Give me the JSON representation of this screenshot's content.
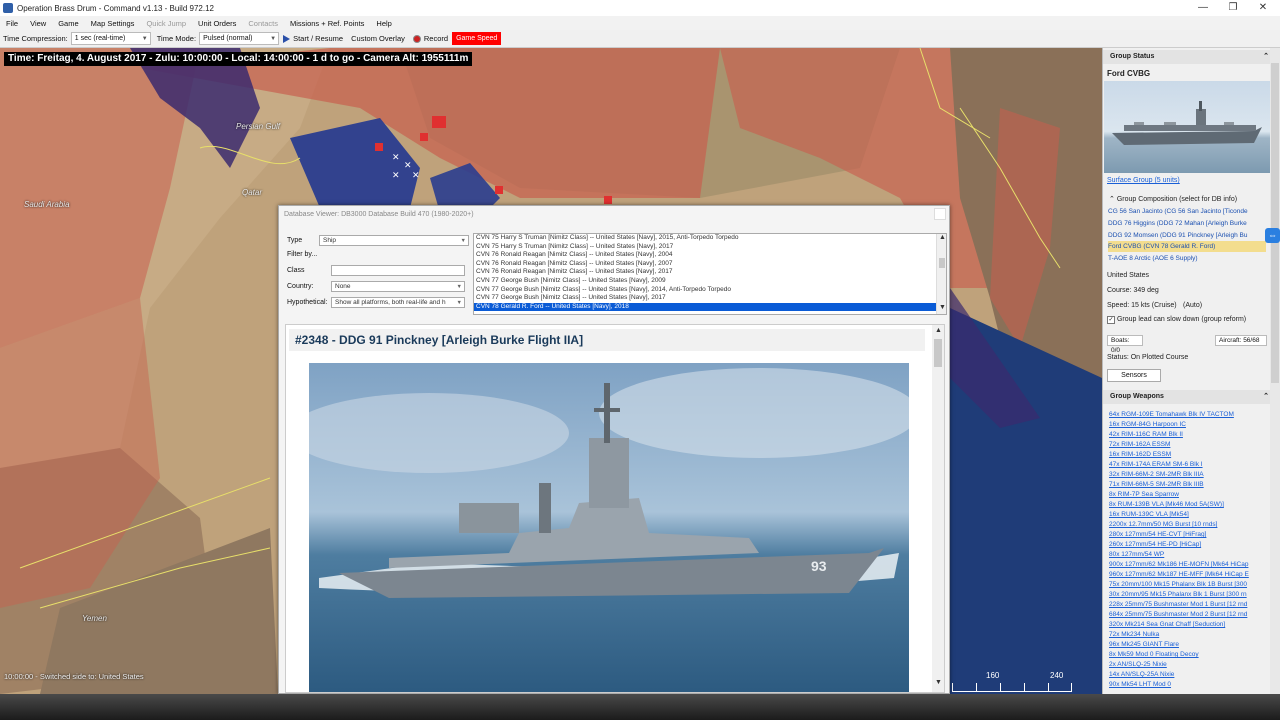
{
  "window": {
    "title": "Operation Brass Drum - Command v1.13 - Build 972.12",
    "minimize": "—",
    "restore": "❐",
    "close": "✕"
  },
  "menu": [
    "File",
    "View",
    "Game",
    "Map Settings",
    "Quick Jump",
    "Unit Orders",
    "Contacts",
    "Missions + Ref. Points",
    "Help"
  ],
  "menu_disabled": [
    "Quick Jump",
    "Contacts"
  ],
  "toolbar": {
    "time_compression_label": "Time Compression:",
    "time_compression_value": "1 sec (real-time)",
    "time_mode_label": "Time Mode:",
    "time_mode_value": "Pulsed (normal)",
    "start_resume": "Start / Resume",
    "custom_overlay": "Custom Overlay",
    "record": "Record",
    "game_speed": "Game Speed"
  },
  "map": {
    "time_readout": "Time: Freitag, 4. August 2017 - Zulu: 10:00:00 - Local: 14:00:00 - 1 d to go - Camera Alt: 1955111m",
    "labels": {
      "persian_gulf": "Persian Gulf",
      "saudi_arabia": "Saudi Arabia",
      "qatar": "Qatar",
      "yemen": "Yemen"
    },
    "status_message": "10:00:00 - Switched side to: United States",
    "scale_labels": [
      "160",
      "240"
    ]
  },
  "database_viewer": {
    "title": "Database Viewer: DB3000 Database Build 470 (1980-2020+)",
    "filters": {
      "type_label": "Type",
      "type_value": "Ship",
      "filter_by_label": "Filter by...",
      "class_label": "Class",
      "class_value": "",
      "country_label": "Country:",
      "country_value": "None",
      "hypothetical_label": "Hypothetical:",
      "hypothetical_value": "Show all platforms, both real-life and h"
    },
    "list_items": [
      "CVN 75 Harry S Truman [Nimitz Class] -- United States [Navy], 2015, Anti-Torpedo Torpedo",
      "CVN 75 Harry S Truman [Nimitz Class] -- United States [Navy], 2017",
      "CVN 76 Ronald Reagan [Nimitz Class] -- United States [Navy], 2004",
      "CVN 76 Ronald Reagan [Nimitz Class] -- United States [Navy], 2007",
      "CVN 76 Ronald Reagan [Nimitz Class] -- United States [Navy], 2017",
      "CVN 77 George Bush [Nimitz Class] -- United States [Navy], 2009",
      "CVN 77 George Bush [Nimitz Class] -- United States [Navy], 2014, Anti-Torpedo Torpedo",
      "CVN 77 George Bush [Nimitz Class] -- United States [Navy], 2017",
      "CVN 78 Gerald R. Ford -- United States [Navy], 2018"
    ],
    "selected_index": 8,
    "detail_heading": "#2348 - DDG 91 Pinckney [Arleigh Burke Flight IIA]",
    "photo_hull_number": "93"
  },
  "group_status": {
    "header": "Group Status",
    "group_name": "Ford CVBG",
    "surface_group_link": "Surface Group (5 units)",
    "composition_label": "Group Composition (select for DB info)",
    "composition": [
      "CG 56 San Jacinto (CG 56 San Jacinto [Ticonde",
      "DDG 76 Higgins (DDG 72 Mahan [Arleigh Burke",
      "DDG 92 Momsen (DDG 91 Pinckney [Arleigh Bu",
      "Ford CVBG (CVN 78 Gerald R. Ford)",
      "T-AOE 8 Arctic (AOE 6 Supply)"
    ],
    "highlighted_index": 3,
    "side": "United States",
    "course": "Course: 349 deg",
    "speed": "Speed: 15 kts (Cruise)",
    "speed_mode": "(Auto)",
    "group_lead_label": "Group lead can slow down (group reform)",
    "boats": "Boats: 0/0",
    "aircraft": "Aircraft: 56/68",
    "status": "Status: On Plotted Course",
    "sensors_button": "Sensors"
  },
  "group_weapons": {
    "header": "Group Weapons",
    "items": [
      "64x RGM-109E Tomahawk Blk IV TACTOM",
      "16x RGM-84G Harpoon IC",
      "42x RIM-116C RAM Blk II",
      "72x RIM-162A ESSM",
      "16x RIM-162D ESSM",
      "47x RIM-174A ERAM SM-6 Blk I",
      "32x RIM-66M-2 SM-2MR Blk IIIA",
      "71x RIM-66M-5 SM-2MR Blk IIIB",
      "8x RIM-7P Sea Sparrow",
      "8x RUM-139B VLA [Mk46 Mod 5A(SW)]",
      "16x RUM-139C VLA [Mk54]",
      "2200x 12.7mm/50 MG Burst [10 rnds]",
      "280x 127mm/54 HE-CVT [HiFrag]",
      "260x 127mm/54 HE-PD [HiCap]",
      "80x 127mm/54 WP",
      "900x 127mm/62 Mk186 HE-MOFN [Mk64 HiCap",
      "960x 127mm/62 Mk187 HE-MFF [Mk64 HiCap E",
      "75x 20mm/100 Mk15 Phalanx Blk 1B Burst [300",
      "30x 20mm/95 Mk15 Phalanx Blk 1 Burst [300 rn",
      "228x 25mm/75 Bushmaster Mod 1 Burst [12 rnd",
      "684x 25mm/75 Bushmaster Mod 2 Burst [12 rnd",
      "320x Mk214 Sea Gnat Chaff [Seduction]",
      "72x Mk234 Nulka",
      "96x Mk245 GIANT Flare",
      "8x Mk59 Mod 0 Floating Decoy",
      "2x AN/SLQ-25 Nixie",
      "14x AN/SLQ-25A Nixie",
      "90x Mk54 LHT Mod 0"
    ]
  }
}
